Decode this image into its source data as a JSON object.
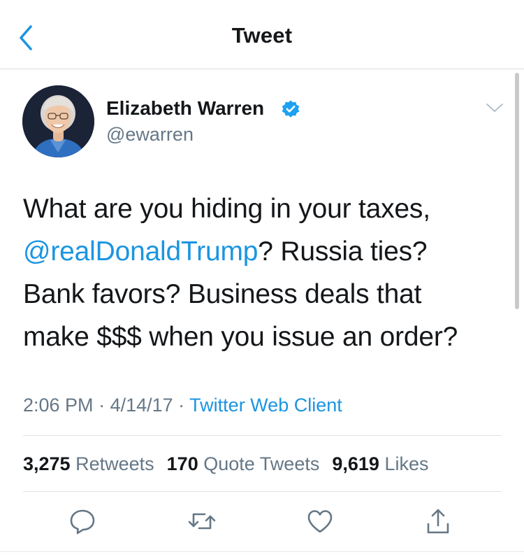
{
  "nav": {
    "title": "Tweet",
    "back_icon": "chevron-left-icon"
  },
  "tweet": {
    "author": {
      "name": "Elizabeth Warren",
      "handle": "@ewarren",
      "verified": true
    },
    "text": {
      "line1": "What are you hiding in your taxes,",
      "mention": "@realDonaldTrump",
      "line2_rest": "? Russia ties?",
      "line3": "Bank favors? Business deals that",
      "line4": "make $$$ when you issue an order?"
    },
    "meta": {
      "time": "2:06 PM",
      "sep1": " · ",
      "date": "4/14/17",
      "sep2": " · ",
      "source": "Twitter Web Client"
    },
    "stats": {
      "retweets_count": "3,275",
      "retweets_label": "Retweets",
      "quotes_count": "170",
      "quotes_label": "Quote Tweets",
      "likes_count": "9,619",
      "likes_label": "Likes"
    },
    "actions": [
      "reply-icon",
      "retweet-icon",
      "like-icon",
      "share-icon"
    ]
  },
  "colors": {
    "link": "#1b95e0",
    "secondary_text": "#657786",
    "primary_text": "#14171a",
    "divider": "#dfe3e6",
    "verified_badge": "#1da1f2"
  }
}
